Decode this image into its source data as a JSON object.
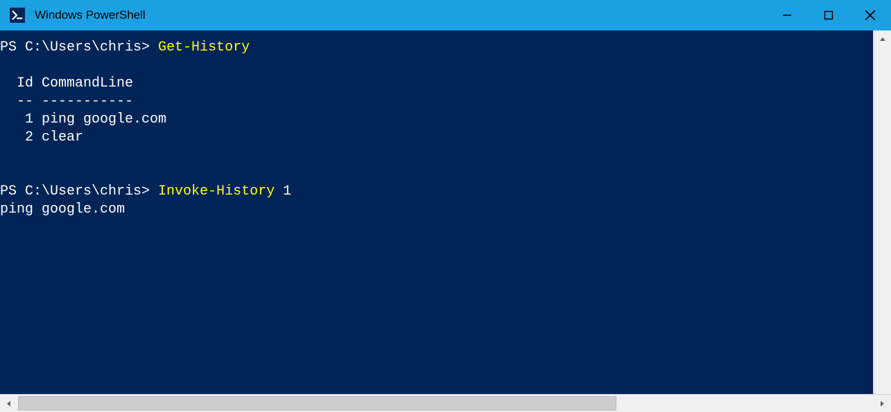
{
  "window": {
    "title": "Windows PowerShell"
  },
  "terminal": {
    "prompt1": "PS C:\\Users\\chris> ",
    "cmd1": "Get-History",
    "blank1": "",
    "header": "  Id CommandLine",
    "divider": "  -- -----------",
    "row1": "   1 ping google.com",
    "row2": "   2 clear",
    "blank2": "",
    "blank3": "",
    "prompt2": "PS C:\\Users\\chris> ",
    "cmd2": "Invoke-History",
    "arg2": " 1",
    "echo": "ping google.com"
  }
}
